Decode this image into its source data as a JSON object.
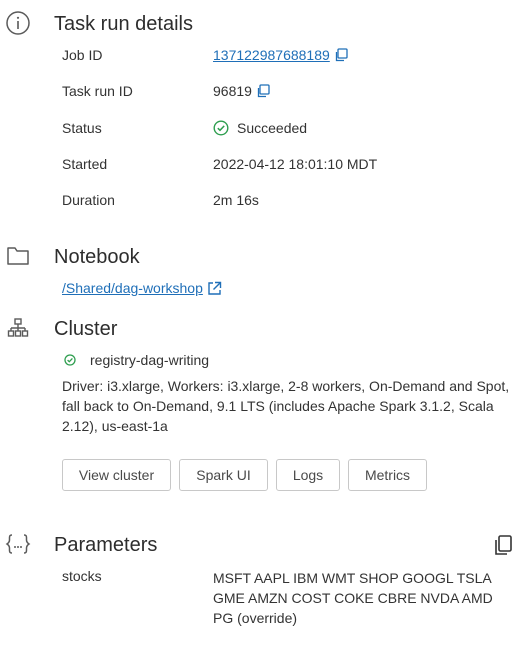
{
  "task_run_details": {
    "title": "Task run details",
    "icon": "info-icon",
    "rows": {
      "job_id": {
        "label": "Job ID",
        "value": "137122987688189"
      },
      "task_run_id": {
        "label": "Task run ID",
        "value": "96819"
      },
      "status": {
        "label": "Status",
        "value": "Succeeded",
        "color": "#2e9e4f"
      },
      "started": {
        "label": "Started",
        "value": "2022-04-12 18:01:10 MDT"
      },
      "duration": {
        "label": "Duration",
        "value": "2m 16s"
      }
    }
  },
  "notebook": {
    "title": "Notebook",
    "icon": "folder-icon",
    "path": "/Shared/dag-workshop"
  },
  "cluster": {
    "title": "Cluster",
    "icon": "cluster-tree-icon",
    "name": "registry-dag-writing",
    "description": "Driver: i3.xlarge, Workers: i3.xlarge, 2-8 workers, On-Demand and Spot, fall back to On-Demand, 9.1 LTS (includes Apache Spark 3.1.2, Scala 2.12), us-east-1a",
    "buttons": {
      "view_cluster": "View cluster",
      "spark_ui": "Spark UI",
      "logs": "Logs",
      "metrics": "Metrics"
    }
  },
  "parameters": {
    "title": "Parameters",
    "icon": "braces-icon",
    "items": [
      {
        "key": "stocks",
        "value": "MSFT AAPL IBM WMT SHOP GOOGL TSLA GME AMZN COST COKE CBRE NVDA AMD PG (override)"
      }
    ]
  },
  "colors": {
    "link": "#1f6fb8",
    "success": "#2e9e4f"
  }
}
